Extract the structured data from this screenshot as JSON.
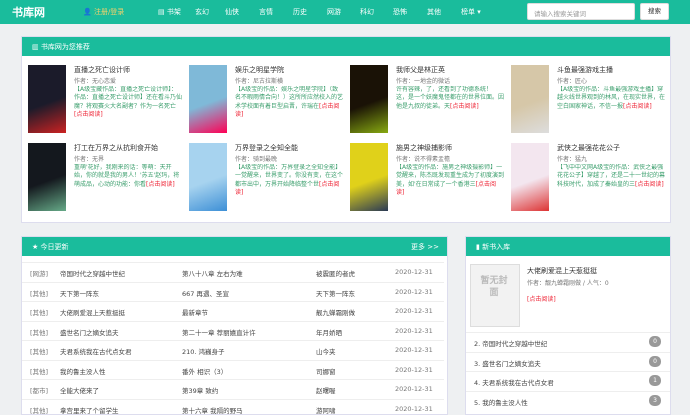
{
  "header": {
    "logo": "书库网",
    "login": "注册/登录",
    "nav": [
      "书架",
      "玄幻",
      "仙侠",
      "言情",
      "历史",
      "网游",
      "科幻",
      "恐怖",
      "其他",
      "榜单 ▾"
    ],
    "search_placeholder": "请输入搜索关键词",
    "search_btn": "搜索"
  },
  "recommend": {
    "title": "书库网为您推荐",
    "books": [
      {
        "title": "直播之死亡设计师",
        "author": "作者：无心恋爱",
        "desc": "【A级宝藏作品：直播之死亡设计师】：作品：直播之死亡设计师】还在看斗乃仙魔？将观赛火大名副者？作为一名死亡",
        "read": "[点击阅读]"
      },
      {
        "title": "娱乐之明星学院",
        "author": "作者：尼古拉斯横",
        "desc": "【A级宝的作品：娱乐之明星学院】（致名不暇雨情合向！）这所所应然校入的艺术学校面有着巨型启晋，许瑞在",
        "read": "[点击阅读]"
      },
      {
        "title": "我师父是林正英",
        "author": "作者：一地金的微话",
        "desc": "许有容辣，了，还看到了功德系统！ 这，是一个妖魔鬼怪都在的世界位面。因他是九叔的徒弟。天",
        "read": "[点击阅读]"
      },
      {
        "title": "斗鱼最强游戏主播",
        "author": "作者：匠心",
        "desc": "【A级宝的作品：斗鱼最强游戏主播】穿越火线世界观到的林风，在现实世界，在空白国家神话，不信一报",
        "read": "[点击阅读]"
      },
      {
        "title": "打工在万界之从抗利食开始",
        "author": "作者：无界",
        "desc": "重萌'花好，我刚来的话：等萌：天开始，你的就是我的男人！'苏五'赵玛，将萌成品，心动的功能：你看",
        "read": "[点击阅读]"
      },
      {
        "title": "万界登录之全知全能",
        "author": "作者：骑到最晚",
        "desc": "【A级宝的作品：万界登录之全知全能】一觉醒来，世界变了。你没有变，在这个都市出中，万界开始降临整个世",
        "read": "[点击阅读]"
      },
      {
        "title": "施男之神级捕影师",
        "author": "作者：说不得素盂檐",
        "desc": "【A级宝的作品：施男之神级摄影师】一觉醒来，陈杰既发现重生成为了初度演到美，如'在日常成了一个香港三",
        "read": "[点击阅读]"
      },
      {
        "title": "武侠之最强花花公子",
        "author": "作者：猛九",
        "desc": "【飞中中文网A级宝的作品：武侠之最强花花公子】穿越了，还是二十一世纪的幕科技时代，加成了秦始皇的三",
        "read": "[点击阅读]"
      }
    ]
  },
  "updates": {
    "title": "今日更新",
    "more": "更多 >>",
    "rows": [
      [
        "[网游]",
        "帝国时代之穿越中世纪",
        "第八十八章 左右为难",
        "被震匿的者虎",
        "2020-12-31"
      ],
      [
        "[其他]",
        "天下第一阵东",
        "667 再遇、圣宣",
        "天下第一阵东",
        "2020-12-31"
      ],
      [
        "[其他]",
        "大佬刷爱混上天惹挺挺",
        "最新章节",
        "靓九蝉霜刚做",
        "2020-12-31"
      ],
      [
        "[其他]",
        "盛世名门之嫡女追夫",
        "第二十一章 荐丽嬉直计许",
        "年月娇晒",
        "2020-12-31"
      ],
      [
        "[其他]",
        "夫君系统我在古代点女君",
        "210. 鸿巍身子",
        "山今夹",
        "2020-12-31"
      ],
      [
        "[其他]",
        "我的鲁主没人性",
        "番外 相识（3）",
        "司娜窗",
        "2020-12-31"
      ],
      [
        "[都市]",
        "全能大佬来了",
        "第39章 致约",
        "赵曙喔",
        "2020-12-31"
      ],
      [
        "[其他]",
        "拿宫里来了个留学生",
        "第十六章 我隔的野马",
        "游阿啸",
        "2020-12-31"
      ]
    ]
  },
  "newbooks": {
    "title": "新书入库",
    "featured": {
      "title": "大佬刷爱混上天惹挺挺",
      "author": "作者：靓九蝉霜刚做 / 人气：0",
      "read": "[点击阅读]",
      "cover": "暂无封面"
    },
    "rows": [
      {
        "t": "2. 帝国时代之穿越中世纪",
        "n": "0"
      },
      {
        "t": "3. 盛世名门之嫡女追夫",
        "n": "0"
      },
      {
        "t": "4. 夫君系统我在古代点女君",
        "n": "1"
      },
      {
        "t": "5. 我的鲁主没人性",
        "n": "3"
      }
    ]
  },
  "colors": {
    "accent": "#1abc9c"
  }
}
